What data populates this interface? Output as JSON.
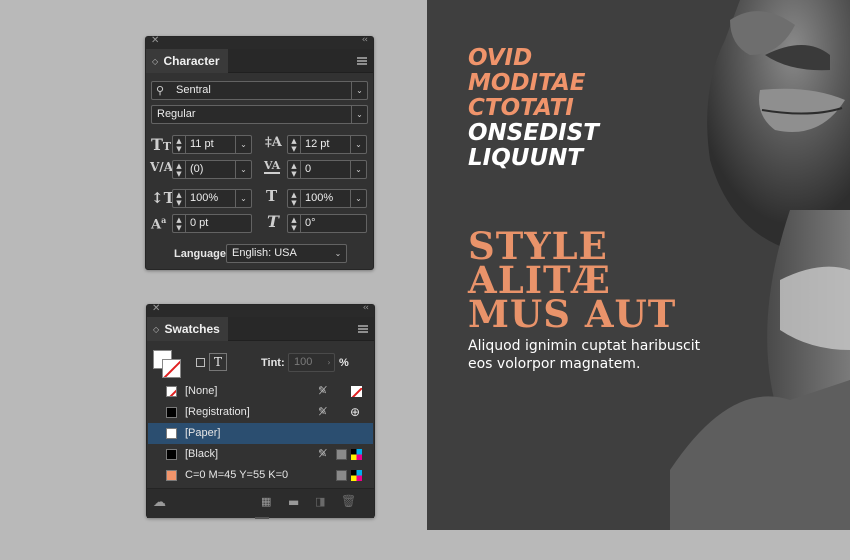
{
  "character_panel": {
    "tab_label": "Character",
    "font_family": "Sentral",
    "font_style": "Regular",
    "font_size": "11 pt",
    "leading": "12 pt",
    "kerning": "(0)",
    "tracking": "0",
    "vertical_scale": "100%",
    "horizontal_scale": "100%",
    "baseline_shift": "0 pt",
    "skew": "0°",
    "language_label": "Language:",
    "language_value": "English: USA"
  },
  "swatches_panel": {
    "tab_label": "Swatches",
    "tint_label": "Tint:",
    "tint_value": "100",
    "tint_unit": "%",
    "rows": [
      {
        "name": "[None]",
        "color": "none"
      },
      {
        "name": "[Registration]",
        "color": "#000000"
      },
      {
        "name": "[Paper]",
        "color": "#ffffff"
      },
      {
        "name": "[Black]",
        "color": "#000000"
      },
      {
        "name": "C=0 M=45 Y=55 K=0",
        "color": "#f0946b"
      }
    ]
  },
  "document": {
    "headline_lines": [
      "OVID",
      "MODITAE",
      "CTOTATI",
      "ONSEDIST",
      "LIQUUNT"
    ],
    "headline_colors": [
      "#f0946b",
      "#f0946b",
      "#f0946b",
      "#ffffff",
      "#ffffff"
    ],
    "display_lines": [
      "STYLE",
      "ALITÆ",
      "MUS AUT"
    ],
    "body_lines": [
      "Aliquod ignimin cuptat haribuscit",
      "eos volorpor magnatem."
    ],
    "accent_color": "#f0946b",
    "background_color": "#3f3f3f"
  }
}
